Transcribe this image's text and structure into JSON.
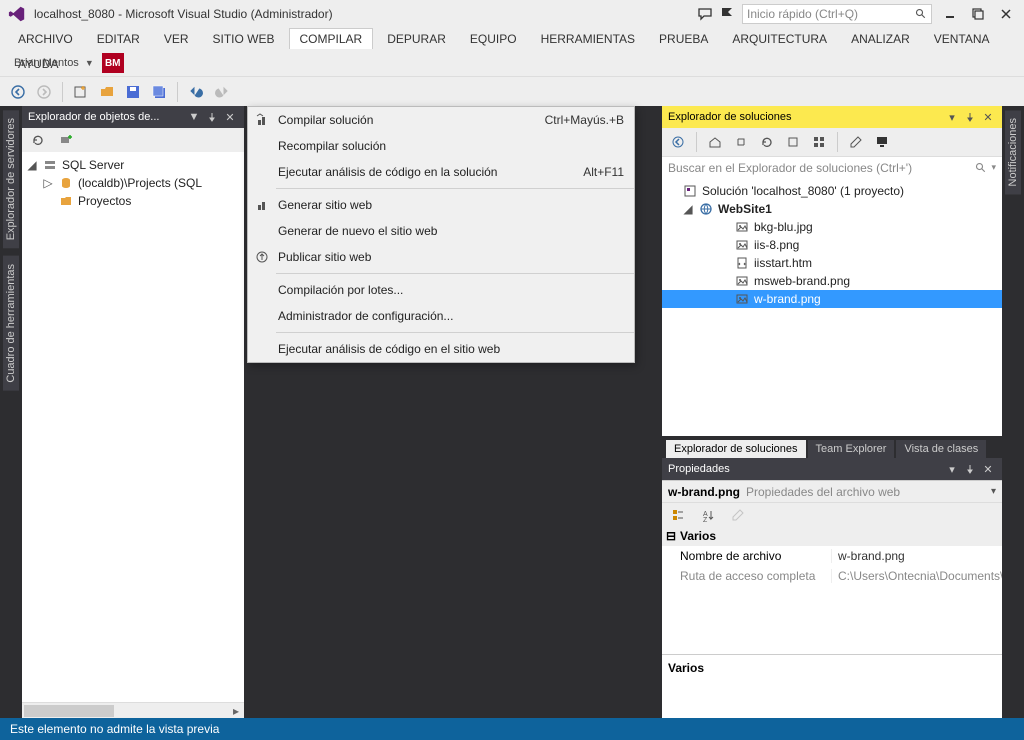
{
  "title": "localhost_8080 - Microsoft Visual Studio (Administrador)",
  "quick_launch_placeholder": "Inicio rápido (Ctrl+Q)",
  "user": {
    "name": "Brian Mentos",
    "badge": "BM"
  },
  "menu": {
    "items": [
      "ARCHIVO",
      "EDITAR",
      "VER",
      "SITIO WEB",
      "COMPILAR",
      "DEPURAR",
      "EQUIPO",
      "HERRAMIENTAS",
      "PRUEBA",
      "ARQUITECTURA",
      "ANALIZAR",
      "VENTANA",
      "AYUDA"
    ],
    "active_index": 4
  },
  "compile_menu": {
    "rows": [
      {
        "icon": "build-solution-icon",
        "label": "Compilar solución",
        "shortcut": "Ctrl+Mayús.+B"
      },
      {
        "icon": "",
        "label": "Recompilar solución",
        "shortcut": ""
      },
      {
        "icon": "",
        "label": "Ejecutar análisis de código en la solución",
        "shortcut": "Alt+F11"
      },
      {
        "sep": true
      },
      {
        "icon": "generate-icon",
        "label": "Generar sitio web",
        "shortcut": ""
      },
      {
        "icon": "",
        "label": "Generar de nuevo el sitio web",
        "shortcut": ""
      },
      {
        "icon": "publish-icon",
        "label": "Publicar sitio web",
        "shortcut": ""
      },
      {
        "sep": true
      },
      {
        "icon": "",
        "label": "Compilación por lotes...",
        "shortcut": ""
      },
      {
        "icon": "",
        "label": "Administrador de configuración...",
        "shortcut": ""
      },
      {
        "sep": true
      },
      {
        "icon": "",
        "label": "Ejecutar análisis de código en el sitio web",
        "shortcut": ""
      }
    ]
  },
  "left_tabs": [
    "Explorador de servidores",
    "Cuadro de herramientas"
  ],
  "right_tabs": [
    "Notificaciones"
  ],
  "object_explorer": {
    "title": "Explorador de objetos de...",
    "nodes": [
      {
        "level": 0,
        "expander": "◢",
        "icon": "server-icon",
        "label": "SQL Server"
      },
      {
        "level": 1,
        "expander": "▷",
        "icon": "db-icon",
        "label": "(localdb)\\Projects (SQL"
      },
      {
        "level": 1,
        "expander": "",
        "icon": "folder-icon",
        "label": "Proyectos"
      }
    ]
  },
  "solution_explorer": {
    "title": "Explorador de soluciones",
    "search_placeholder": "Buscar en el Explorador de soluciones (Ctrl+')",
    "solution_line": "Solución 'localhost_8080' (1 proyecto)",
    "nodes": [
      {
        "level": 0,
        "expander": "◢",
        "icon": "globe-icon",
        "label": "WebSite1",
        "bold": true
      },
      {
        "level": 1,
        "icon": "image-icon",
        "label": "bkg-blu.jpg"
      },
      {
        "level": 1,
        "icon": "image-icon",
        "label": "iis-8.png"
      },
      {
        "level": 1,
        "icon": "html-icon",
        "label": "iisstart.htm"
      },
      {
        "level": 1,
        "icon": "image-icon",
        "label": "msweb-brand.png"
      },
      {
        "level": 1,
        "icon": "image-icon",
        "label": "w-brand.png",
        "selected": true
      }
    ],
    "bottom_tabs": [
      "Explorador de soluciones",
      "Team Explorer",
      "Vista de clases"
    ],
    "bottom_active": 0
  },
  "properties": {
    "title": "Propiedades",
    "combo": "w-brand.png Propiedades del archivo web",
    "category": "Varios",
    "rows": [
      {
        "k": "Nombre de archivo",
        "v": "w-brand.png",
        "dis": false
      },
      {
        "k": "Ruta de acceso completa",
        "v": "C:\\Users\\Ontecnia\\Documents\\M",
        "dis": true
      }
    ],
    "desc_title": "Varios"
  },
  "status": "Este elemento no admite la vista previa"
}
